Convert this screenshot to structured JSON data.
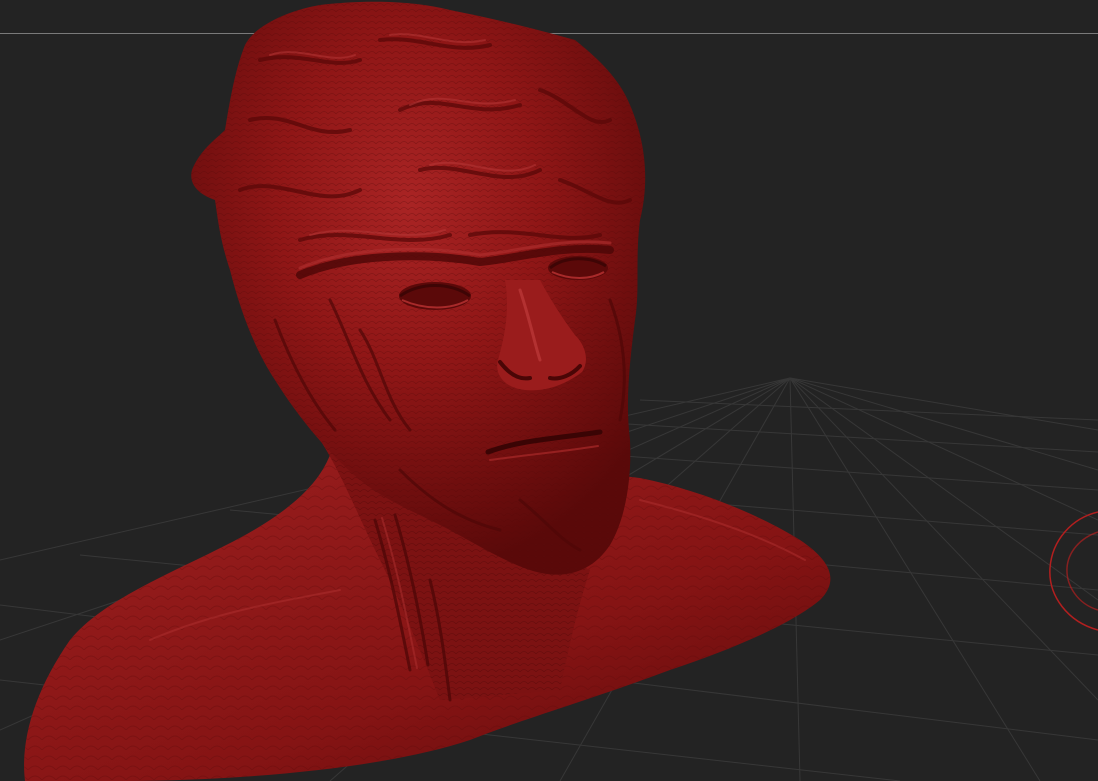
{
  "app": {
    "view": "3d-sculpt-viewport"
  },
  "viewport": {
    "background_color": "#232323",
    "grid_color": "#3b3b3b",
    "grid": true
  },
  "model": {
    "name": "",
    "material_color": "#8f1616",
    "shadow_color": "#4d0707",
    "highlight_color": "#b23131",
    "icons": [
      "sculpted-bust"
    ]
  },
  "gizmo": {
    "color": "#b21f1f",
    "icons": [
      "rotation-gizmo-icon"
    ]
  }
}
